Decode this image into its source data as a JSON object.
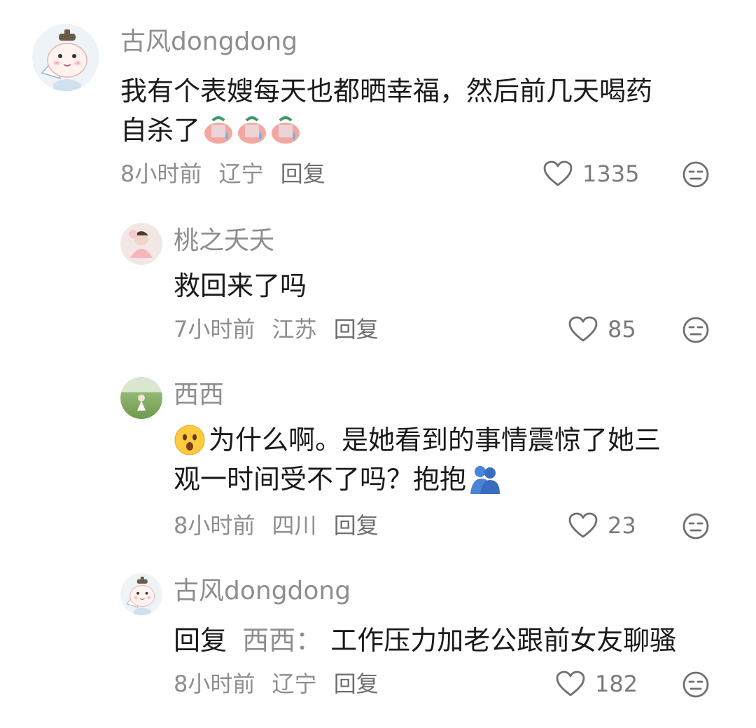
{
  "comments": [
    {
      "user": "古风dongdong",
      "text_lines": [
        "我有个表嫂每天也都晒幸福，然后前几天喝药",
        "自杀了"
      ],
      "time": "8小时前",
      "location": "辽宁",
      "reply_label": "回复",
      "likes": "1335"
    },
    {
      "user": "桃之夭夭",
      "text_lines": [
        "救回来了吗"
      ],
      "time": "7小时前",
      "location": "江苏",
      "reply_label": "回复",
      "likes": "85"
    },
    {
      "user": "西西",
      "text_lines": [
        "为什么啊。是她看到的事情震惊了她三",
        "观一时间受不了吗？抱抱"
      ],
      "time": "8小时前",
      "location": "四川",
      "reply_label": "回复",
      "likes": "23"
    },
    {
      "user": "古风dongdong",
      "reply_prefix": "回复",
      "reply_target": "西西：",
      "text_lines": [
        "工作压力加老公跟前女友聊骚"
      ],
      "time": "8小时前",
      "location": "辽宁",
      "reply_label": "回复",
      "likes": "182"
    }
  ],
  "icons": {
    "like": "heart-outline-icon",
    "dislike": "neutral-face-icon",
    "emoji_cry": "crying-emoji",
    "emoji_surprised": "surprised-face-emoji",
    "emoji_hug": "people-hugging-emoji"
  },
  "colors": {
    "name": "#8e8e8e",
    "text": "#1a1a1a",
    "meta": "#8e8e8e",
    "icon": "#6f6f6f"
  }
}
